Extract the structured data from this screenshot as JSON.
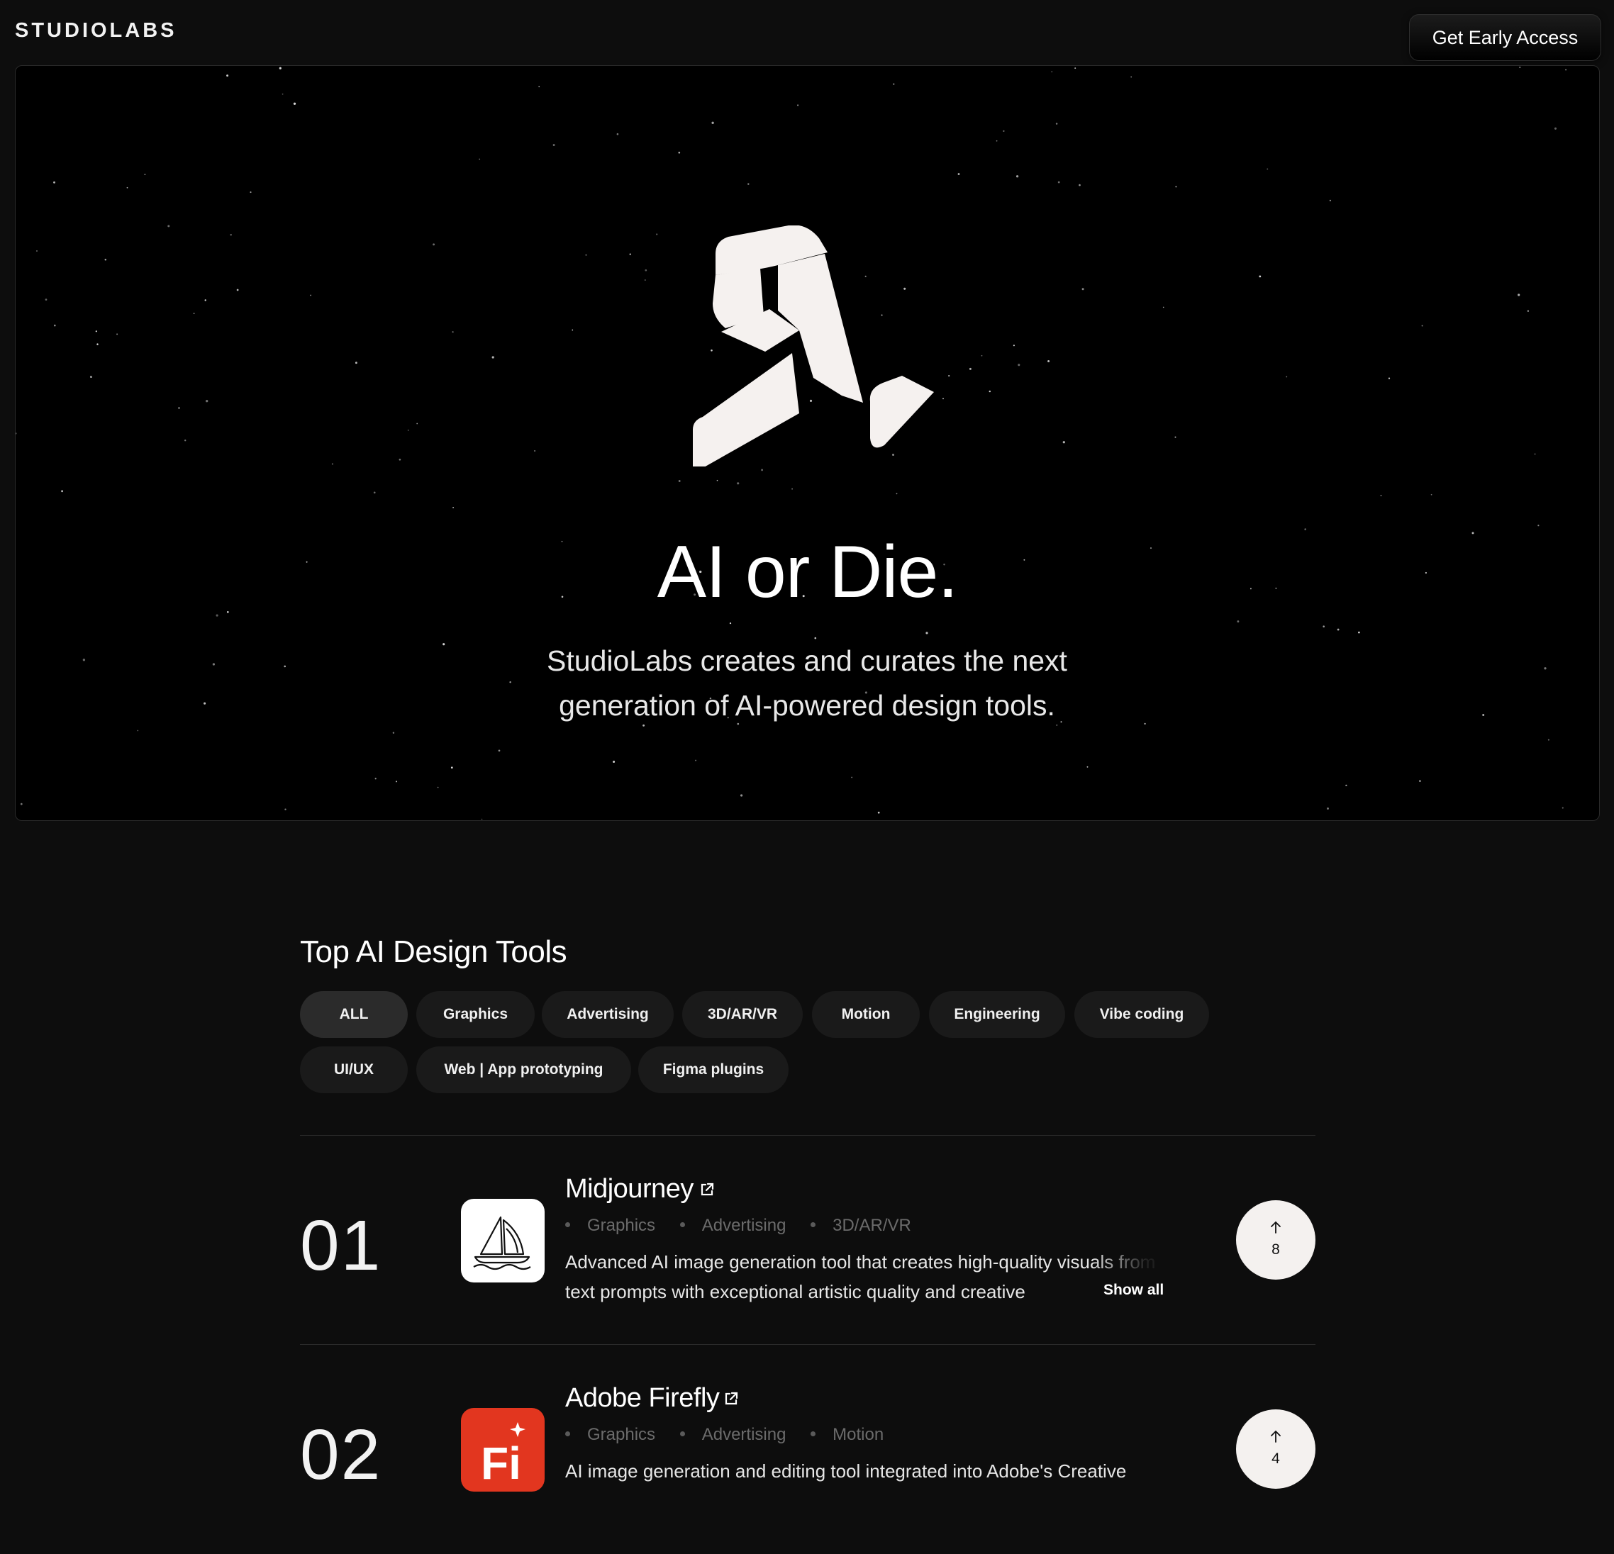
{
  "header": {
    "brand": "STUDIOLABS",
    "cta_label": "Get Early Access"
  },
  "hero": {
    "title": "AI or Die.",
    "subtitle": "StudioLabs creates and curates the next generation of AI-powered design tools."
  },
  "tools_section": {
    "title": "Top AI Design Tools",
    "filters": [
      {
        "label": "ALL",
        "active": true
      },
      {
        "label": "Graphics",
        "active": false
      },
      {
        "label": "Advertising",
        "active": false
      },
      {
        "label": "3D/AR/VR",
        "active": false
      },
      {
        "label": "Motion",
        "active": false
      },
      {
        "label": "Engineering",
        "active": false
      },
      {
        "label": "Vibe coding",
        "active": false
      },
      {
        "label": "UI/UX",
        "active": false
      },
      {
        "label": "Web | App prototyping",
        "active": false
      },
      {
        "label": "Figma plugins",
        "active": false
      }
    ],
    "tools": [
      {
        "rank": "01",
        "name": "Midjourney",
        "icon": "sailboat-icon",
        "tags": [
          "Graphics",
          "Advertising",
          "3D/AR/VR"
        ],
        "description": "Advanced AI image generation tool that creates high-quality visuals from text prompts with exceptional artistic quality and creative",
        "show_all_label": "Show all",
        "votes": "8"
      },
      {
        "rank": "02",
        "name": "Adobe Firefly",
        "icon": "firefly-icon",
        "icon_text": "Fi",
        "tags": [
          "Graphics",
          "Advertising",
          "Motion"
        ],
        "description": "AI image generation and editing tool integrated into Adobe's Creative",
        "votes": "4"
      }
    ]
  },
  "colors": {
    "page_bg": "#0d0d0d",
    "hero_bg": "#000000",
    "chip_bg": "#1a1a1a",
    "chip_active_bg": "#2b2b2b",
    "vote_bg": "#f4f1ef",
    "firefly_red": "#e2361f"
  }
}
